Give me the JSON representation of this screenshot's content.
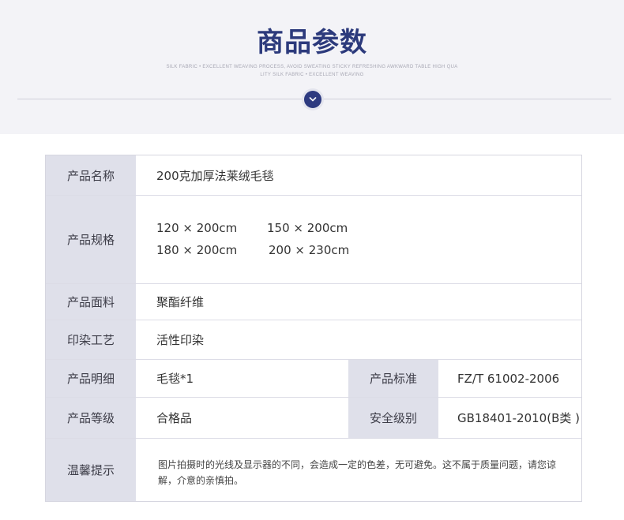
{
  "header": {
    "title": "商品参数",
    "subtitle_line1": "SILK FABRIC • EXCELLENT WEAVING PROCESS, AVOID SWEATING STICKY REFRESHING AWKWARD TABLE HIGH QUA",
    "subtitle_line2": "LITY SILK FABRIC • EXCELLENT WEAVING",
    "accent_color": "#2c3a7c",
    "icon": "chevron-down-icon"
  },
  "params": {
    "name": {
      "label": "产品名称",
      "value": "200克加厚法莱绒毛毯"
    },
    "spec": {
      "label": "产品规格",
      "sizes": [
        "120 × 200cm",
        "150 × 200cm",
        "180 × 200cm",
        "200 × 230cm"
      ]
    },
    "material": {
      "label": "产品面料",
      "value": "聚酯纤维"
    },
    "process": {
      "label": "印染工艺",
      "value": "活性印染"
    },
    "detail": {
      "label": "产品明细",
      "value": "毛毯*1"
    },
    "standard": {
      "label": "产品标准",
      "value": "FZ/T 61002-2006"
    },
    "grade": {
      "label": "产品等级",
      "value": "合格品"
    },
    "safety": {
      "label": "安全级别",
      "value": "GB18401-2010(B类 )"
    },
    "notice": {
      "label": "温馨提示",
      "value": "图片拍摄时的光线及显示器的不同，会造成一定的色差，无可避免。这不属于质量问题，请您谅解，介意的亲慎拍。"
    }
  }
}
